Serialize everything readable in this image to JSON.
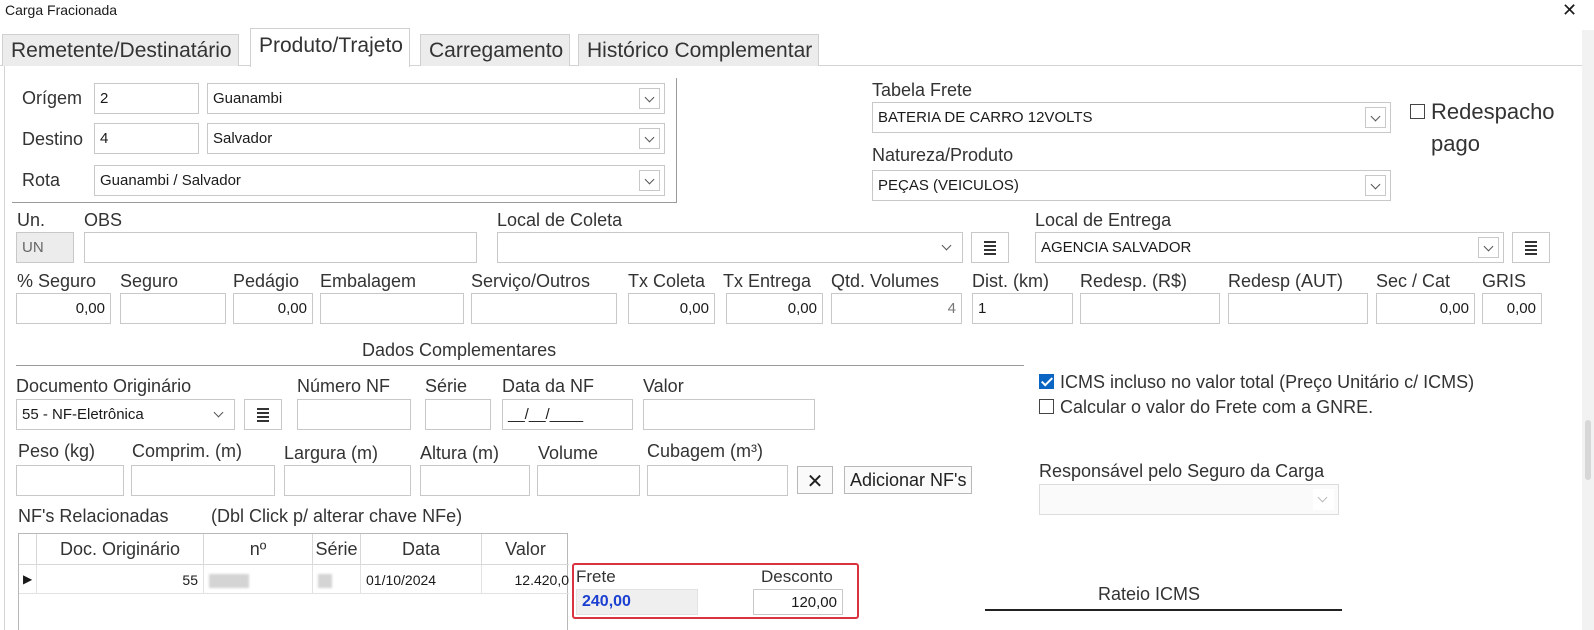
{
  "window": {
    "title": "Carga Fracionada"
  },
  "tabs": [
    {
      "label": "Remetente/Destinatário"
    },
    {
      "label": "Produto/Trajeto"
    },
    {
      "label": "Carregamento"
    },
    {
      "label": "Histórico Complementar"
    }
  ],
  "trajeto": {
    "origem_label": "Orígem",
    "origem_code": "2",
    "origem_city": "Guanambi",
    "destino_label": "Destino",
    "destino_code": "4",
    "destino_city": "Salvador",
    "rota_label": "Rota",
    "rota_value": "Guanambi / Salvador"
  },
  "tabela_frete": {
    "label": "Tabela Frete",
    "value": "BATERIA DE CARRO 12VOLTS"
  },
  "natureza": {
    "label": "Natureza/Produto",
    "value": "PEÇAS (VEICULOS)"
  },
  "redespacho": {
    "label_line1": "Redespacho",
    "label_line2": "pago",
    "checked": false
  },
  "un": {
    "label": "Un.",
    "value": "UN"
  },
  "obs": {
    "label": "OBS",
    "value": ""
  },
  "local_coleta": {
    "label": "Local de Coleta",
    "value": ""
  },
  "local_entrega": {
    "label": "Local de Entrega",
    "value": "AGENCIA SALVADOR"
  },
  "valores": {
    "seguro_pct": {
      "label": "% Seguro",
      "value": "0,00"
    },
    "seguro": {
      "label": "Seguro",
      "value": ""
    },
    "pedagio": {
      "label": "Pedágio",
      "value": "0,00"
    },
    "embalagem": {
      "label": "Embalagem",
      "value": ""
    },
    "servico": {
      "label": "Serviço/Outros",
      "value": ""
    },
    "tx_coleta": {
      "label": "Tx Coleta",
      "value": "0,00"
    },
    "tx_entrega": {
      "label": "Tx Entrega",
      "value": "0,00"
    },
    "qtd_volumes": {
      "label": "Qtd. Volumes",
      "value": "4"
    },
    "dist": {
      "label": "Dist. (km)",
      "value": "1"
    },
    "redesp_rs": {
      "label": "Redesp. (R$)",
      "value": ""
    },
    "redesp_aut": {
      "label": "Redesp (AUT)",
      "value": ""
    },
    "sec_cat": {
      "label": "Sec / Cat",
      "value": "0,00"
    },
    "gris": {
      "label": "GRIS",
      "value": "0,00"
    }
  },
  "dados_complementares": {
    "title": "Dados Complementares"
  },
  "documento": {
    "doc_label": "Documento Originário",
    "doc_value": "55 - NF-Eletrônica",
    "numero_label": "Número NF",
    "numero_value": "",
    "serie_label": "Série",
    "serie_value": "",
    "data_label": "Data da NF",
    "data_value": "__/__/____",
    "valor_label": "Valor",
    "valor_value": ""
  },
  "medidas": {
    "peso_label": "Peso (kg)",
    "comprim_label": "Comprim. (m)",
    "largura_label": "Largura (m)",
    "altura_label": "Altura (m)",
    "volume_label": "Volume",
    "cubagem_label": "Cubagem (m³)"
  },
  "buttons": {
    "clear": "✕",
    "adicionar": "Adicionar NF's"
  },
  "icms": {
    "incluso_label": "ICMS incluso no valor total (Preço Unitário c/ ICMS)",
    "incluso_checked": true,
    "gnre_label": "Calcular o valor do Frete com a GNRE.",
    "gnre_checked": false
  },
  "responsavel": {
    "label": "Responsável pelo Seguro da Carga",
    "value": ""
  },
  "nfs": {
    "title": "NF's Relacionadas",
    "hint": "(Dbl Click p/ alterar chave NFe)",
    "columns": [
      "Doc. Originário",
      "nº",
      "Série",
      "Data",
      "Valor"
    ],
    "rows": [
      {
        "doc": "55",
        "numero": "",
        "serie": "",
        "data": "01/10/2024",
        "valor": "12.420,0"
      }
    ]
  },
  "frete": {
    "frete_label": "Frete",
    "frete_value": "240,00",
    "desconto_label": "Desconto",
    "desconto_value": "120,00"
  },
  "rateio": {
    "label": "Rateio ICMS"
  },
  "colors": {
    "accent": "#0a66c2",
    "highlight_border": "#d9333f",
    "frete_value": "#1a3fd1"
  }
}
